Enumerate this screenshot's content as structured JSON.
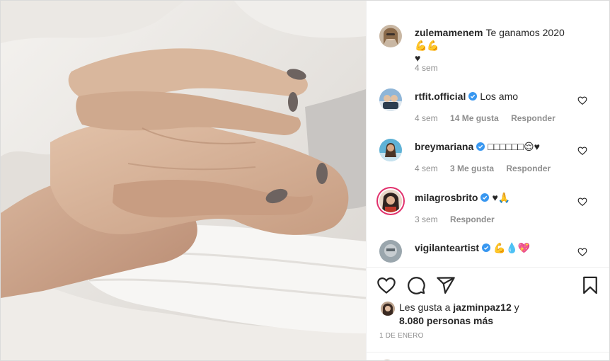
{
  "post": {
    "image_alt": "Hands clasped together on a hospital bed",
    "caption": {
      "username": "zulemamenem",
      "text": "Te ganamos 2020 💪💪",
      "text_line2": "♥",
      "time": "4 sem"
    },
    "comments": [
      {
        "username": "rtfit.official",
        "verified": true,
        "text": "Los amo",
        "time": "4 sem",
        "likes": "14 Me gusta",
        "reply": "Responder"
      },
      {
        "username": "breymariana",
        "verified": true,
        "text": "□□□□□□😌♥",
        "time": "4 sem",
        "likes": "3 Me gusta",
        "reply": "Responder"
      },
      {
        "username": "milagrosbrito",
        "verified": true,
        "text": "♥🙏",
        "time": "3 sem",
        "likes": "",
        "reply": "Responder"
      },
      {
        "username": "vigilanteartist",
        "verified": true,
        "text": "💪💧💖",
        "time": "",
        "likes": "",
        "reply": ""
      }
    ],
    "liked_by": {
      "prefix": "Les gusta a",
      "user": "jazminpaz12",
      "connector": "y",
      "others": "8.080 personas más"
    },
    "date": "1 DE ENERO"
  },
  "colors": {
    "text": "#262626",
    "muted": "#8e8e8e",
    "verified": "#3897f0",
    "border": "#dbdbdb"
  },
  "icons": {
    "like": "heart-icon",
    "comment": "comment-bubble-icon",
    "share": "paper-plane-icon",
    "save": "bookmark-icon",
    "verified": "verified-badge-icon"
  }
}
